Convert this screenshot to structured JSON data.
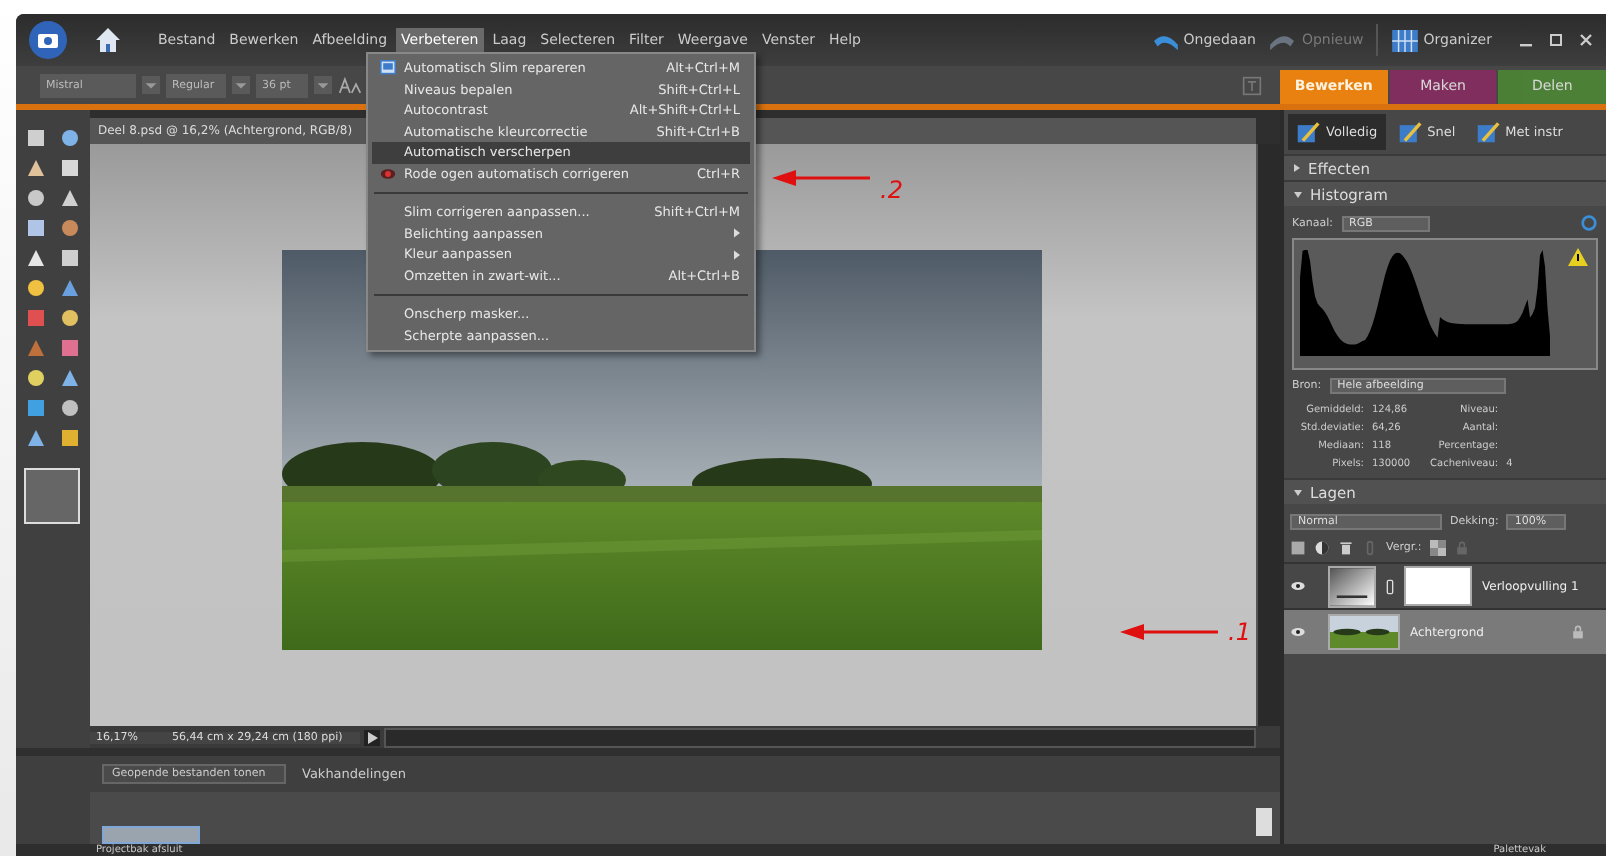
{
  "menubar": {
    "menus": [
      {
        "label": "Bestand",
        "selected": false
      },
      {
        "label": "Bewerken",
        "selected": false
      },
      {
        "label": "Afbeelding",
        "selected": false
      },
      {
        "label": "Verbeteren",
        "selected": true
      },
      {
        "label": "Laag",
        "selected": false
      },
      {
        "label": "Selecteren",
        "selected": false
      },
      {
        "label": "Filter",
        "selected": false
      },
      {
        "label": "Weergave",
        "selected": false
      },
      {
        "label": "Venster",
        "selected": false
      },
      {
        "label": "Help",
        "selected": false
      }
    ],
    "undo": "Ongedaan",
    "redo": "Opnieuw",
    "organizer": "Organizer"
  },
  "options_bar": {
    "font": "Mistral",
    "style": "Regular",
    "size": "36 pt"
  },
  "dropdown": {
    "groups": [
      [
        {
          "label": "Automatisch Slim repareren",
          "shortcut": "Alt+Ctrl+M",
          "kind": "action",
          "has_icon": true,
          "selected": false
        },
        {
          "label": "Niveaus bepalen",
          "shortcut": "Shift+Ctrl+L",
          "kind": "action",
          "has_icon": false,
          "selected": false
        },
        {
          "label": "Autocontrast",
          "shortcut": "Alt+Shift+Ctrl+L",
          "kind": "action",
          "has_icon": false,
          "selected": false
        },
        {
          "label": "Automatische kleurcorrectie",
          "shortcut": "Shift+Ctrl+B",
          "kind": "action",
          "has_icon": false,
          "selected": false
        },
        {
          "label": "Automatisch verscherpen",
          "kind": "action",
          "has_icon": false,
          "selected": true
        },
        {
          "label": "Rode ogen automatisch corrigeren",
          "shortcut": "Ctrl+R",
          "kind": "action",
          "has_icon": true,
          "selected": false
        }
      ],
      [
        {
          "label": "Slim corrigeren aanpassen...",
          "shortcut": "Shift+Ctrl+M",
          "kind": "action",
          "has_icon": false,
          "selected": false
        },
        {
          "label": "Belichting aanpassen",
          "kind": "submenu",
          "has_icon": false,
          "selected": false
        },
        {
          "label": "Kleur aanpassen",
          "kind": "submenu",
          "has_icon": false,
          "selected": false
        },
        {
          "label": "Omzetten in zwart-wit...",
          "shortcut": "Alt+Ctrl+B",
          "kind": "action",
          "has_icon": false,
          "selected": false
        }
      ],
      [
        {
          "label": "Onscherp masker...",
          "kind": "action",
          "has_icon": false,
          "selected": false
        },
        {
          "label": "Scherpte aanpassen...",
          "kind": "action",
          "has_icon": false,
          "selected": false
        }
      ]
    ]
  },
  "document": {
    "title": "Deel 8.psd @ 16,2% (Achtergrond, RGB/8)",
    "zoom": "16,17%",
    "size": "56,44 cm x 29,24 cm (180 ppi)"
  },
  "project_bin": {
    "dropdown": "Geopende bestanden tonen",
    "menu": "Vakhandelingen"
  },
  "mode_tabs": [
    {
      "label": "Bewerken",
      "selected": true,
      "color": "#e8810f"
    },
    {
      "label": "Maken",
      "selected": false,
      "color": "#8a2a62"
    },
    {
      "label": "Delen",
      "selected": false,
      "color": "#4c8a34"
    }
  ],
  "edit_tabs": [
    {
      "label": "Volledig",
      "selected": true
    },
    {
      "label": "Snel",
      "selected": false
    },
    {
      "label": "Met instr",
      "selected": false
    }
  ],
  "effects": {
    "title": "Effecten",
    "expanded": false
  },
  "histogram": {
    "title": "Histogram",
    "expanded": true,
    "channel_label": "Kanaal:",
    "channel": "RGB",
    "source_label": "Bron:",
    "source": "Hele afbeelding",
    "stats_left": [
      {
        "label": "Gemiddeld:",
        "value": "124,86"
      },
      {
        "label": "Std.deviatie:",
        "value": "64,26"
      },
      {
        "label": "Mediaan:",
        "value": "118"
      },
      {
        "label": "Pixels:",
        "value": "130000"
      }
    ],
    "stats_right": [
      {
        "label": "Niveau:"
      },
      {
        "label": "Aantal:"
      },
      {
        "label": "Percentage:"
      },
      {
        "label": "Cacheniveau:",
        "value": "4"
      }
    ]
  },
  "layers": {
    "title": "Lagen",
    "expanded": true,
    "blend": "Normal",
    "opacity_label": "Dekking:",
    "opacity": "100%",
    "lock_label": "Vergr.:",
    "items": [
      {
        "name": "Verloopvulling 1",
        "kind": "fill",
        "selected": false,
        "visible": true
      },
      {
        "name": "Achtergrond",
        "selected": true,
        "visible": true
      }
    ]
  },
  "annotations": [
    {
      "label": ".2"
    },
    {
      "label": ".1"
    }
  ],
  "footer": {
    "left": "Projectbak afsluit",
    "right": "Palettevak"
  }
}
